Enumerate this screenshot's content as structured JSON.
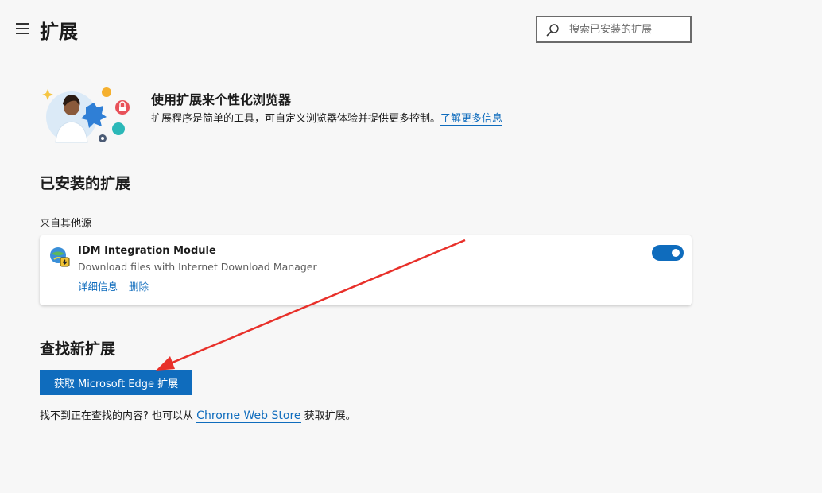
{
  "header": {
    "title": "扩展",
    "search_placeholder": "搜索已安装的扩展"
  },
  "intro": {
    "title": "使用扩展来个性化浏览器",
    "description": "扩展程序是简单的工具，可自定义浏览器体验并提供更多控制。",
    "learn_more": "了解更多信息"
  },
  "installed": {
    "heading": "已安装的扩展",
    "source_label": "来自其他源",
    "extensions": [
      {
        "name": "IDM Integration Module",
        "description": "Download files with Internet Download Manager",
        "details_label": "详细信息",
        "remove_label": "删除",
        "enabled": true
      }
    ]
  },
  "find": {
    "heading": "查找新扩展",
    "button_label": "获取 Microsoft Edge 扩展",
    "prefix": "找不到正在查找的内容? 也可以从 ",
    "store_link": "Chrome Web Store",
    "suffix": " 获取扩展。"
  },
  "colors": {
    "accent": "#0f6cbd",
    "annotation_arrow": "#e8302a"
  }
}
